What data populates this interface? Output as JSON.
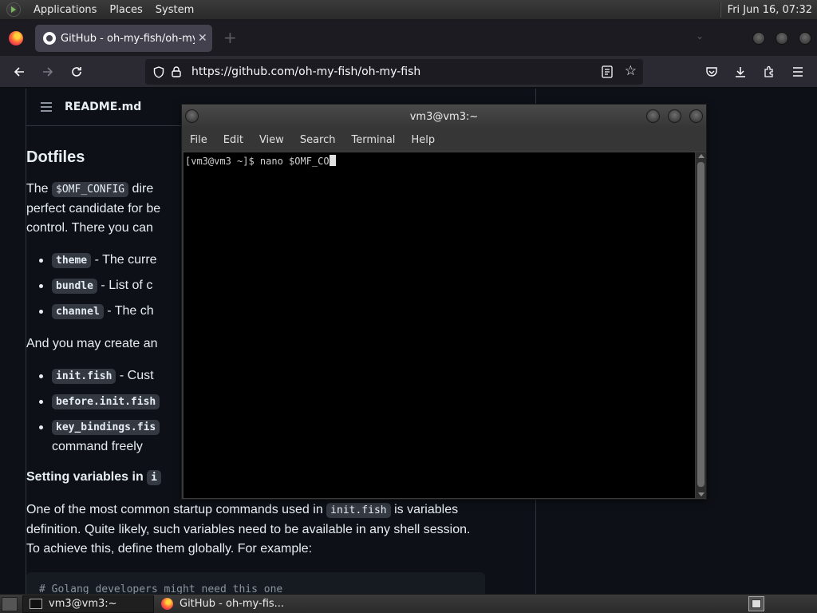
{
  "top_panel": {
    "menus": [
      "Applications",
      "Places",
      "System"
    ],
    "clock": "Fri Jun 16, 07:32"
  },
  "browser": {
    "tab_title": "GitHub - oh-my-fish/oh-my",
    "url": "https://github.com/oh-my-fish/oh-my-fish"
  },
  "readme": {
    "file_name": "README.md",
    "heading": "Dotfiles",
    "p1_pre": "The ",
    "p1_code": "$OMF_CONFIG",
    "p1_line1": " dire",
    "p1_line2": "perfect candidate for be",
    "p1_line3": "control. There you can",
    "list1": [
      {
        "code": "theme",
        "text": " - The curre"
      },
      {
        "code": "bundle",
        "text": " - List of c"
      },
      {
        "code": "channel",
        "text": " - The ch"
      }
    ],
    "p2": "And you may create an",
    "list2": [
      {
        "code": "init.fish",
        "text": " - Cust"
      },
      {
        "code": "before.init.fish",
        "text": ""
      },
      {
        "code": "key_bindings.fis",
        "text": "",
        "continuation": "command freely"
      }
    ],
    "subheading": "Setting variables in",
    "subheading_code": "i",
    "p3_pre": "One of the most common startup commands used in ",
    "p3_code": "init.fish",
    "p3_post": " is variables",
    "p3_line2": "definition. Quite likely, such variables need to be available in any shell session.",
    "p3_line3": "To achieve this, define them globally. For example:",
    "code_comment": "# Golang developers might need this one"
  },
  "terminal": {
    "title": "vm3@vm3:~",
    "menu": [
      "File",
      "Edit",
      "View",
      "Search",
      "Terminal",
      "Help"
    ],
    "prompt": "[vm3@vm3 ~]$ nano $OMF_CO"
  },
  "bottom_panel": {
    "tasks": [
      "vm3@vm3:~",
      "GitHub - oh-my-fis..."
    ]
  }
}
